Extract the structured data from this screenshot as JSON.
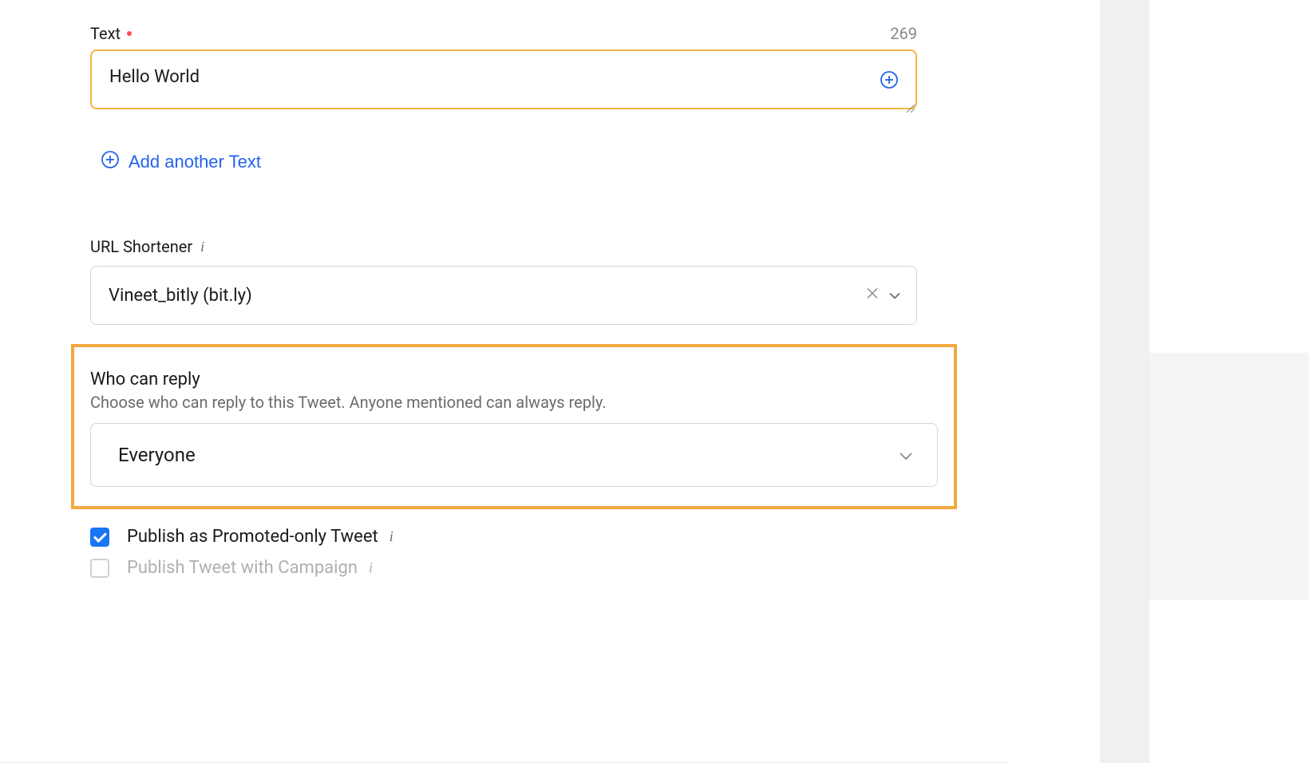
{
  "text_section": {
    "label": "Text",
    "char_count": "269",
    "value": "Hello World"
  },
  "add_text": {
    "label": "Add another Text"
  },
  "url_shortener": {
    "label": "URL Shortener",
    "selected": "Vineet_bitly (bit.ly)"
  },
  "who_can_reply": {
    "title": "Who can reply",
    "description": "Choose who can reply to this Tweet. Anyone mentioned can always reply.",
    "selected": "Everyone"
  },
  "checkboxes": {
    "promoted": {
      "label": "Publish as Promoted-only Tweet",
      "checked": true
    },
    "campaign": {
      "label": "Publish Tweet with Campaign",
      "checked": false
    }
  }
}
